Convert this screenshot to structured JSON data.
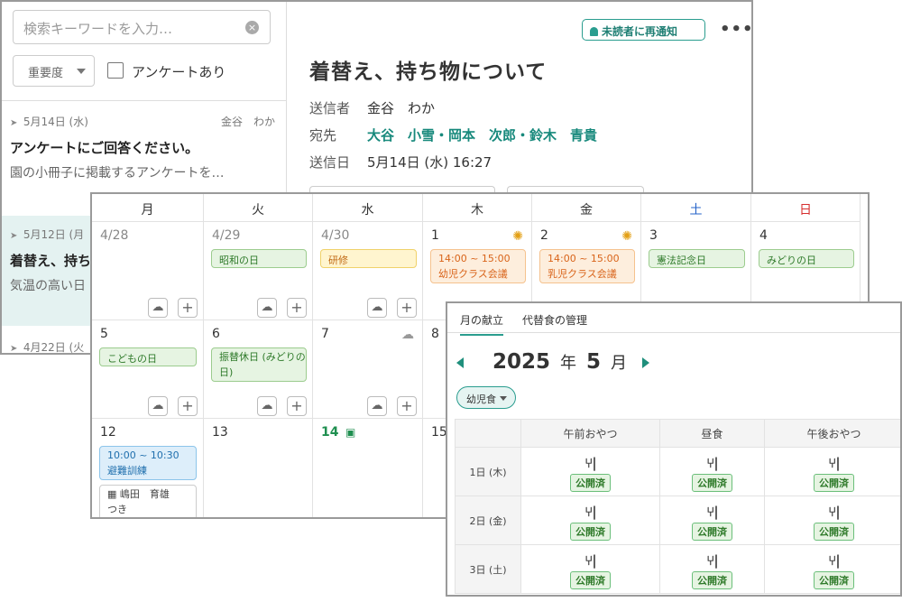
{
  "messages": {
    "search": {
      "placeholder": "検索キーワードを入力…",
      "clear_icon": "clear-icon"
    },
    "filter": {
      "importance": "重要度",
      "survey_checkbox": "アンケートあり"
    },
    "items": [
      {
        "date": "5月14日 (水)",
        "sender": "金谷　わか",
        "title": "アンケートにご回答ください。",
        "body": "園の小冊子に掲載するアンケートを…"
      },
      {
        "date": "5月12日 (月",
        "title": "着替え、持ち",
        "body": "気温の高い日"
      },
      {
        "date": "4月22日 (火"
      }
    ],
    "detail": {
      "resend_label": "未読者に再通知",
      "more": "•••",
      "title": "着替え、持ち物について",
      "sender_label": "送信者",
      "sender_value": "金谷　わか",
      "to_label": "宛先",
      "recipients": [
        "大谷",
        "小雪・岡本",
        "次郎・鈴木",
        "青貴"
      ],
      "sent_label": "送信日",
      "sent_value": "5月14日 (水) 16:27"
    }
  },
  "calendar": {
    "weekdays": [
      "月",
      "火",
      "水",
      "木",
      "金",
      "土",
      "日"
    ],
    "weekday_colors": {
      "sat": "#2563c9",
      "sun": "#d62f2f"
    },
    "week1": [
      {
        "date": "4/28"
      },
      {
        "date": "4/29",
        "tag": "昭和の日"
      },
      {
        "date": "4/30",
        "tag": "研修"
      },
      {
        "date": "1",
        "event_time": "14:00 ~ 15:00",
        "event_name": "幼児クラス会議"
      },
      {
        "date": "2",
        "event_time": "14:00 ~ 15:00",
        "event_name": "乳児クラス会議"
      },
      {
        "date": "3",
        "tag": "憲法記念日"
      },
      {
        "date": "4",
        "tag": "みどりの日"
      }
    ],
    "week2": [
      {
        "date": "5",
        "tag": "こどもの日"
      },
      {
        "date": "6",
        "tag": "振替休日 (みどりの日)"
      },
      {
        "date": "7"
      },
      {
        "date": "8"
      }
    ],
    "week3": [
      {
        "date": "12",
        "event_time": "10:00 ~ 10:30",
        "event_name": "避難訓練",
        "visit_name": "嶋田　育雄",
        "visit_note": "つき"
      },
      {
        "date": "13"
      },
      {
        "date": "14"
      },
      {
        "date": "15"
      }
    ]
  },
  "menu": {
    "tabs": [
      "月の献立",
      "代替食の管理"
    ],
    "year": "2025",
    "year_suffix": "年",
    "month": "5",
    "month_suffix": "月",
    "type_select": "幼児食",
    "columns": [
      "午前おやつ",
      "昼食",
      "午後おやつ"
    ],
    "rows": [
      {
        "day": "1日 (木)",
        "status": "公開済"
      },
      {
        "day": "2日 (金)",
        "status": "公開済"
      },
      {
        "day": "3日 (土)",
        "status": "公開済"
      }
    ]
  }
}
